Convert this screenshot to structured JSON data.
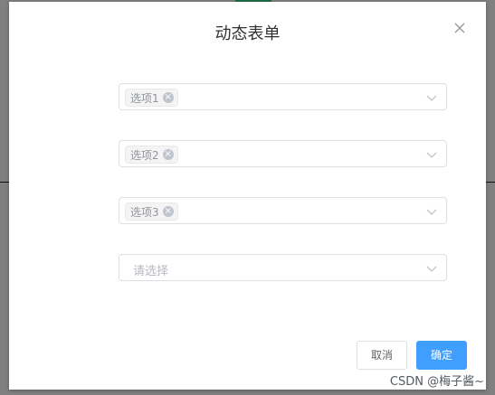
{
  "dialog": {
    "title": "动态表单",
    "fields": [
      {
        "tag_label": "选项1"
      },
      {
        "tag_label": "选项2"
      },
      {
        "tag_label": "选项3"
      }
    ],
    "empty_select": {
      "placeholder": "请选择"
    },
    "cancel_label": "取消",
    "confirm_label": "确定"
  },
  "watermark": "CSDN @梅子酱~",
  "colors": {
    "primary": "#409eff",
    "tag_bg": "#f4f4f5",
    "border": "#dcdfe6"
  },
  "icons": {
    "close": "close-icon",
    "tag_remove": "tag-close-icon",
    "select_arrow": "chevron-down-icon"
  }
}
